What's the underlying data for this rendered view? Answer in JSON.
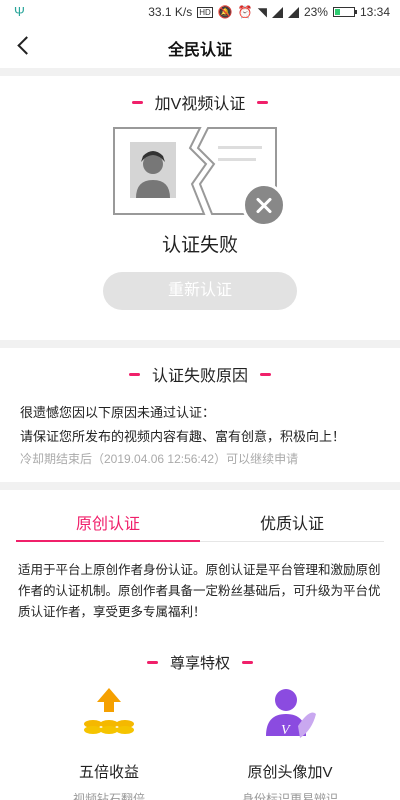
{
  "status_bar": {
    "left_icon": "usb-icon",
    "speed": "33.1 K/s",
    "hd_label": "HD",
    "battery": "23%",
    "battery_level": 0.23,
    "time": "13:34"
  },
  "nav": {
    "title": "全民认证",
    "back_icon": "back-arrow-icon"
  },
  "video_verification": {
    "title": "加V视频认证",
    "status_text": "认证失败",
    "retry_label": "重新认证"
  },
  "failure_reason": {
    "title": "认证失败原因",
    "line1": "很遗憾您因以下原因未通过认证：",
    "line2": "请保证您所发布的视频内容有趣、富有创意，积极向上！",
    "cooldown": "冷却期结束后（2019.04.06 12:56:42）可以继续申请"
  },
  "tabs": {
    "items": [
      {
        "label": "原创认证"
      },
      {
        "label": "优质认证"
      }
    ],
    "active_index": 0
  },
  "original_desc": "适用于平台上原创作者身份认证。原创认证是平台管理和激励原创作者的认证机制。原创作者具备一定粉丝基础后，可升级为平台优质认证作者，享受更多专属福利！",
  "privileges": {
    "title": "尊享特权",
    "items": [
      {
        "icon": "coins-up-icon",
        "title": "五倍收益",
        "sub": "视频钻石翻倍"
      },
      {
        "icon": "avatar-v-icon",
        "title": "原创头像加V",
        "sub": "身份标识更易辨识"
      }
    ]
  },
  "colors": {
    "accent": "#f0206a",
    "coin": "#f5b800",
    "purple": "#8b4be0",
    "disabled_button": "#e2e2e2"
  }
}
